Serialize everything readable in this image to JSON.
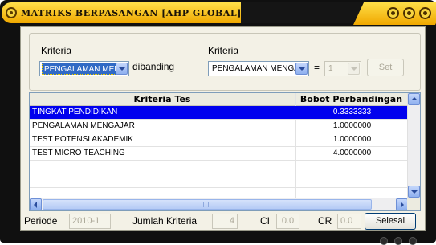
{
  "window": {
    "title": "MATRIKS BERPASANGAN [AHP GLOBAL]",
    "colors": {
      "accent": "#f0a800",
      "selection": "#0000ee"
    }
  },
  "controls": {
    "kriteria1_label": "Kriteria",
    "kriteria1_value": "PENGALAMAN MENGAJAR",
    "dibanding_label": "dibanding",
    "kriteria2_label": "Kriteria",
    "kriteria2_value": "PENGALAMAN MENGAJAR",
    "equals": "=",
    "weight_value": "1",
    "set_label": "Set"
  },
  "table": {
    "columns": [
      "Kriteria Tes",
      "Bobot Perbandingan"
    ],
    "rows": [
      {
        "kriteria": "TINGKAT PENDIDIKAN",
        "bobot": "0.3333333",
        "selected": true
      },
      {
        "kriteria": "PENGALAMAN MENGAJAR",
        "bobot": "1.0000000"
      },
      {
        "kriteria": "TEST POTENSI AKADEMIK",
        "bobot": "1.0000000"
      },
      {
        "kriteria": "TEST MICRO TEACHING",
        "bobot": "4.0000000"
      },
      {
        "kriteria": "",
        "bobot": ""
      },
      {
        "kriteria": "",
        "bobot": ""
      },
      {
        "kriteria": "",
        "bobot": ""
      }
    ]
  },
  "footer": {
    "periode_label": "Periode",
    "periode_value": "2010-1",
    "jumlah_label": "Jumlah Kriteria",
    "jumlah_value": "4",
    "ci_label": "CI",
    "ci_value": "0.0",
    "cr_label": "CR",
    "cr_value": "0.0",
    "selesai_label": "Selesai"
  }
}
